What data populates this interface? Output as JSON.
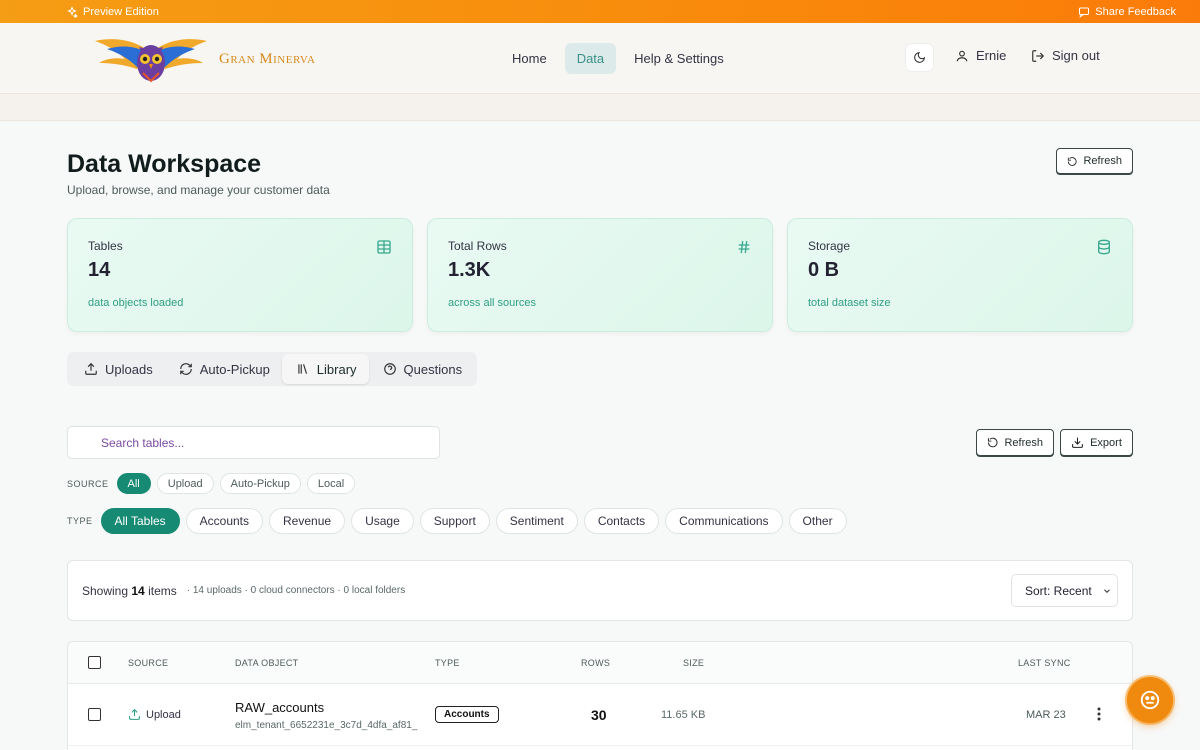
{
  "banner": {
    "left": "Preview Edition",
    "right": "Share Feedback"
  },
  "brand": {
    "name": "Gran Minerva"
  },
  "nav": {
    "items": [
      "Home",
      "Data",
      "Help & Settings"
    ],
    "active": "Data",
    "user": "Ernie",
    "signout": "Sign out"
  },
  "page": {
    "title": "Data Workspace",
    "subtitle": "Upload, browse, and manage your customer data",
    "refresh": "Refresh"
  },
  "cards": [
    {
      "label": "Tables",
      "value": "14",
      "note": "data objects loaded",
      "icon": "table-icon"
    },
    {
      "label": "Total Rows",
      "value": "1.3K",
      "note": "across all sources",
      "icon": "hash-icon"
    },
    {
      "label": "Storage",
      "value": "0 B",
      "note": "total dataset size",
      "icon": "database-icon"
    }
  ],
  "tabs": [
    {
      "label": "Uploads",
      "icon": "upload-icon"
    },
    {
      "label": "Auto-Pickup",
      "icon": "refresh-icon"
    },
    {
      "label": "Library",
      "icon": "library-icon",
      "active": true
    },
    {
      "label": "Questions",
      "icon": "help-circle-icon"
    }
  ],
  "search": {
    "placeholder": "Search tables..."
  },
  "actions": {
    "refresh": "Refresh",
    "export": "Export"
  },
  "source_filter": {
    "label": "SOURCE",
    "options": [
      "All",
      "Upload",
      "Auto-Pickup",
      "Local"
    ],
    "active": "All"
  },
  "type_filter": {
    "label": "TYPE",
    "options": [
      "All Tables",
      "Accounts",
      "Revenue",
      "Usage",
      "Support",
      "Sentiment",
      "Contacts",
      "Communications",
      "Other"
    ],
    "active": "All Tables"
  },
  "summary": {
    "prefix": "Showing",
    "count": "14",
    "suffix": "items",
    "meta": "· 14 uploads · 0 cloud connectors · 0 local folders",
    "sort": "Sort: Recent"
  },
  "table": {
    "headers": {
      "source": "SOURCE",
      "object": "DATA OBJECT",
      "type": "TYPE",
      "rows": "ROWS",
      "size": "SIZE",
      "sync": "LAST SYNC"
    },
    "rows": [
      {
        "source": "Upload",
        "name": "RAW_accounts",
        "sub": "elm_tenant_6652231e_3c7d_4dfa_af81_",
        "type": "Accounts",
        "rows": "30",
        "size": "11.65 KB",
        "sync": "MAR 23"
      }
    ]
  },
  "colors": {
    "accent": "#178a73",
    "banner": "#f98a0b",
    "nav_active_bg": "#dcebea"
  }
}
